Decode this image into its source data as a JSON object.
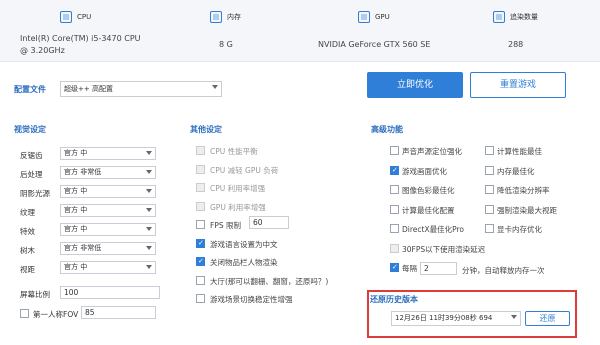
{
  "system": {
    "cpu_label": "CPU",
    "cpu_value_line1": "Intel(R) Core(TM) i5-3470 CPU",
    "cpu_value_line2": "@ 3.20GHz",
    "mem_label": "内存",
    "mem_value": "8 G",
    "gpu_label": "GPU",
    "gpu_value": "NVIDIA GeForce GTX 560 SE",
    "tex_label": "追染数量",
    "tex_value": "288"
  },
  "config": {
    "label": "配置文件",
    "selected": "超级++ 高配置",
    "optimize_button": "立即优化",
    "reset_button": "重置游戏"
  },
  "visual": {
    "title": "视觉设定",
    "rows": [
      {
        "label": "反锯齿",
        "value": "官方 中"
      },
      {
        "label": "后处理",
        "value": "官方 非常低"
      },
      {
        "label": "阴影光源",
        "value": "官方 中"
      },
      {
        "label": "纹理",
        "value": "官方 中"
      },
      {
        "label": "特效",
        "value": "官方 中"
      },
      {
        "label": "树木",
        "value": "官方 非常低"
      },
      {
        "label": "视距",
        "value": "官方 中"
      }
    ],
    "screen_ratio_label": "屏幕比例",
    "screen_ratio_value": "100",
    "fov_label": "第一人称FOV",
    "fov_value": "85"
  },
  "other": {
    "title": "其他设定",
    "items": [
      {
        "label": "CPU 性能平衡"
      },
      {
        "label": "CPU 减轻 GPU 负荷"
      },
      {
        "label": "CPU 利用率增强"
      },
      {
        "label": "GPU 利用率增强"
      },
      {
        "label": "FPS 限制"
      },
      {
        "label": "游戏语言设置为中文"
      },
      {
        "label": "关闭物品栏人物渲染"
      },
      {
        "label": "大厅(那可以翻栅、翻窗，还原吗？)"
      },
      {
        "label": "游戏场景切换稳定性增强"
      }
    ],
    "fps_value": "60"
  },
  "advanced": {
    "title": "高级功能",
    "left": [
      {
        "label": "声音声源定位强化"
      },
      {
        "label": "游戏画面优化"
      },
      {
        "label": "图像色彩最佳化"
      },
      {
        "label": "计算最佳化配置"
      },
      {
        "label": "DirectX最佳化Pro"
      },
      {
        "label": "30FPS以下使用渲染延迟"
      },
      {
        "label": "每隔"
      }
    ],
    "right": [
      {
        "label": "计算性能最佳"
      },
      {
        "label": "内存最佳化"
      },
      {
        "label": "降低渲染分辨率"
      },
      {
        "label": "强制渲染最大视距"
      },
      {
        "label": "显卡内存优化"
      }
    ],
    "interval_value": "2",
    "interval_suffix": "分钟，自动释放内存一次"
  },
  "restore": {
    "title": "还原历史版本",
    "selected": "12月26日 11时39分08秒 694",
    "button": "还原"
  },
  "colors": {
    "accent": "#2f7fd8",
    "highlight_border": "#e03a3a"
  }
}
